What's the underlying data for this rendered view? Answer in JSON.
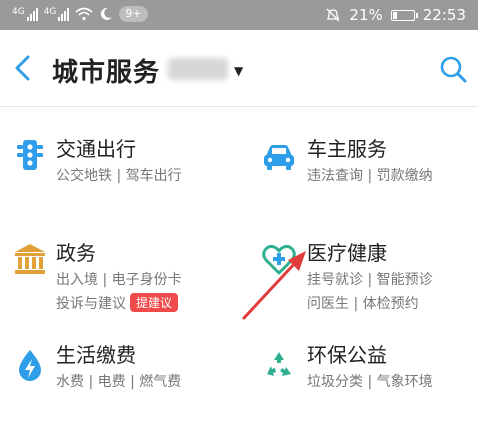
{
  "status_bar": {
    "net1": "4G",
    "net2": "4G",
    "badge": "9+",
    "battery_pct_text": "21%",
    "battery_level": 0.21,
    "time": "22:53"
  },
  "header": {
    "title": "城市服务"
  },
  "services": [
    {
      "title": "交通出行",
      "subs": [
        "公交地铁 | 驾车出行"
      ],
      "icon": "traffic-light-icon"
    },
    {
      "title": "车主服务",
      "subs": [
        "违法查询 | 罚款缴纳"
      ],
      "icon": "car-icon"
    },
    {
      "title": "政务",
      "subs": [
        "出入境 | 电子身份卡",
        "投诉与建议"
      ],
      "tag": "提建议",
      "icon": "government-building-icon"
    },
    {
      "title": "医疗健康",
      "subs": [
        "挂号就诊 | 智能预诊",
        "问医生 | 体检预约"
      ],
      "icon": "medical-heart-icon"
    },
    {
      "title": "生活缴费",
      "subs": [
        "水费 | 电费 | 燃气费"
      ],
      "icon": "water-drop-bolt-icon"
    },
    {
      "title": "环保公益",
      "subs": [
        "垃圾分类 | 气象环境"
      ],
      "icon": "recycle-icon"
    }
  ],
  "colors": {
    "accent": "#2f9ee8",
    "gold": "#e0a13a",
    "green": "#2eaf8f",
    "tag": "#f04a4a",
    "arrow": "#e23b3b"
  }
}
